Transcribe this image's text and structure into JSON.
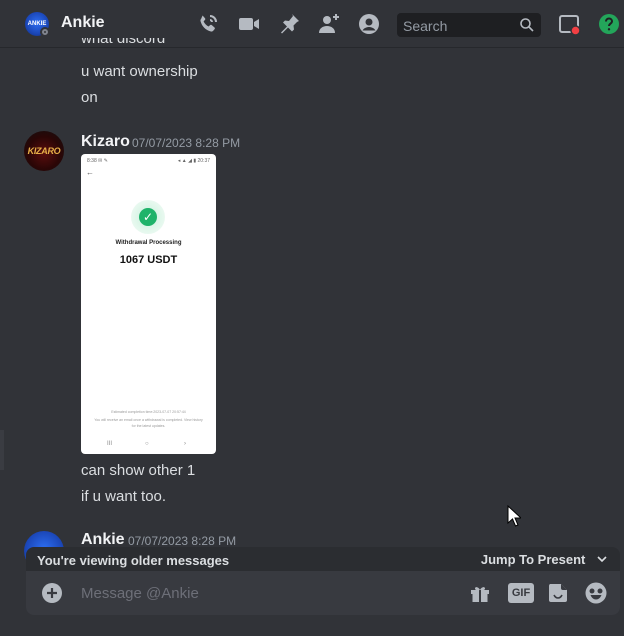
{
  "header": {
    "title": "Ankie",
    "avatar_text": "ANKIE",
    "search_placeholder": "Search",
    "icons": [
      "phone-call-icon",
      "video-call-icon",
      "pin-icon",
      "add-friend-icon",
      "user-profile-icon",
      "inbox-icon",
      "help-icon"
    ]
  },
  "messages": {
    "prev_lines": [
      "what discord",
      "u want ownership",
      "on"
    ],
    "kizaro": {
      "username": "Kizaro",
      "timestamp": "07/07/2023 8:28 PM",
      "avatar_text": "KIZARO",
      "attachment": {
        "status_left": "8:38 ✉ ✎",
        "status_right": "◂ ▲ ◢ ▮ 20:37",
        "label": "Withdrawal Processing",
        "amount": "1067 USDT",
        "footer_line1": "Estimated completion time:2023-07-07 20:57:44",
        "footer_line2": "You will receive an email once a withdrawal is completed. View history",
        "footer_line3": "for the latest updates.",
        "nav": [
          "III",
          "○",
          "›"
        ]
      },
      "lines": [
        "can show other 1",
        "if u want too."
      ]
    },
    "ankie": {
      "username": "Ankie",
      "timestamp": "07/07/2023 8:28 PM"
    }
  },
  "older_bar": {
    "text": "You're viewing older messages",
    "jump_label": "Jump To Present"
  },
  "composer": {
    "placeholder": "Message @Ankie",
    "gif_label": "GIF"
  },
  "colors": {
    "background": "#313338",
    "composer": "#383a40",
    "older_bar": "#2b2d31",
    "help": "#23a55a",
    "notification": "#f23f43"
  }
}
